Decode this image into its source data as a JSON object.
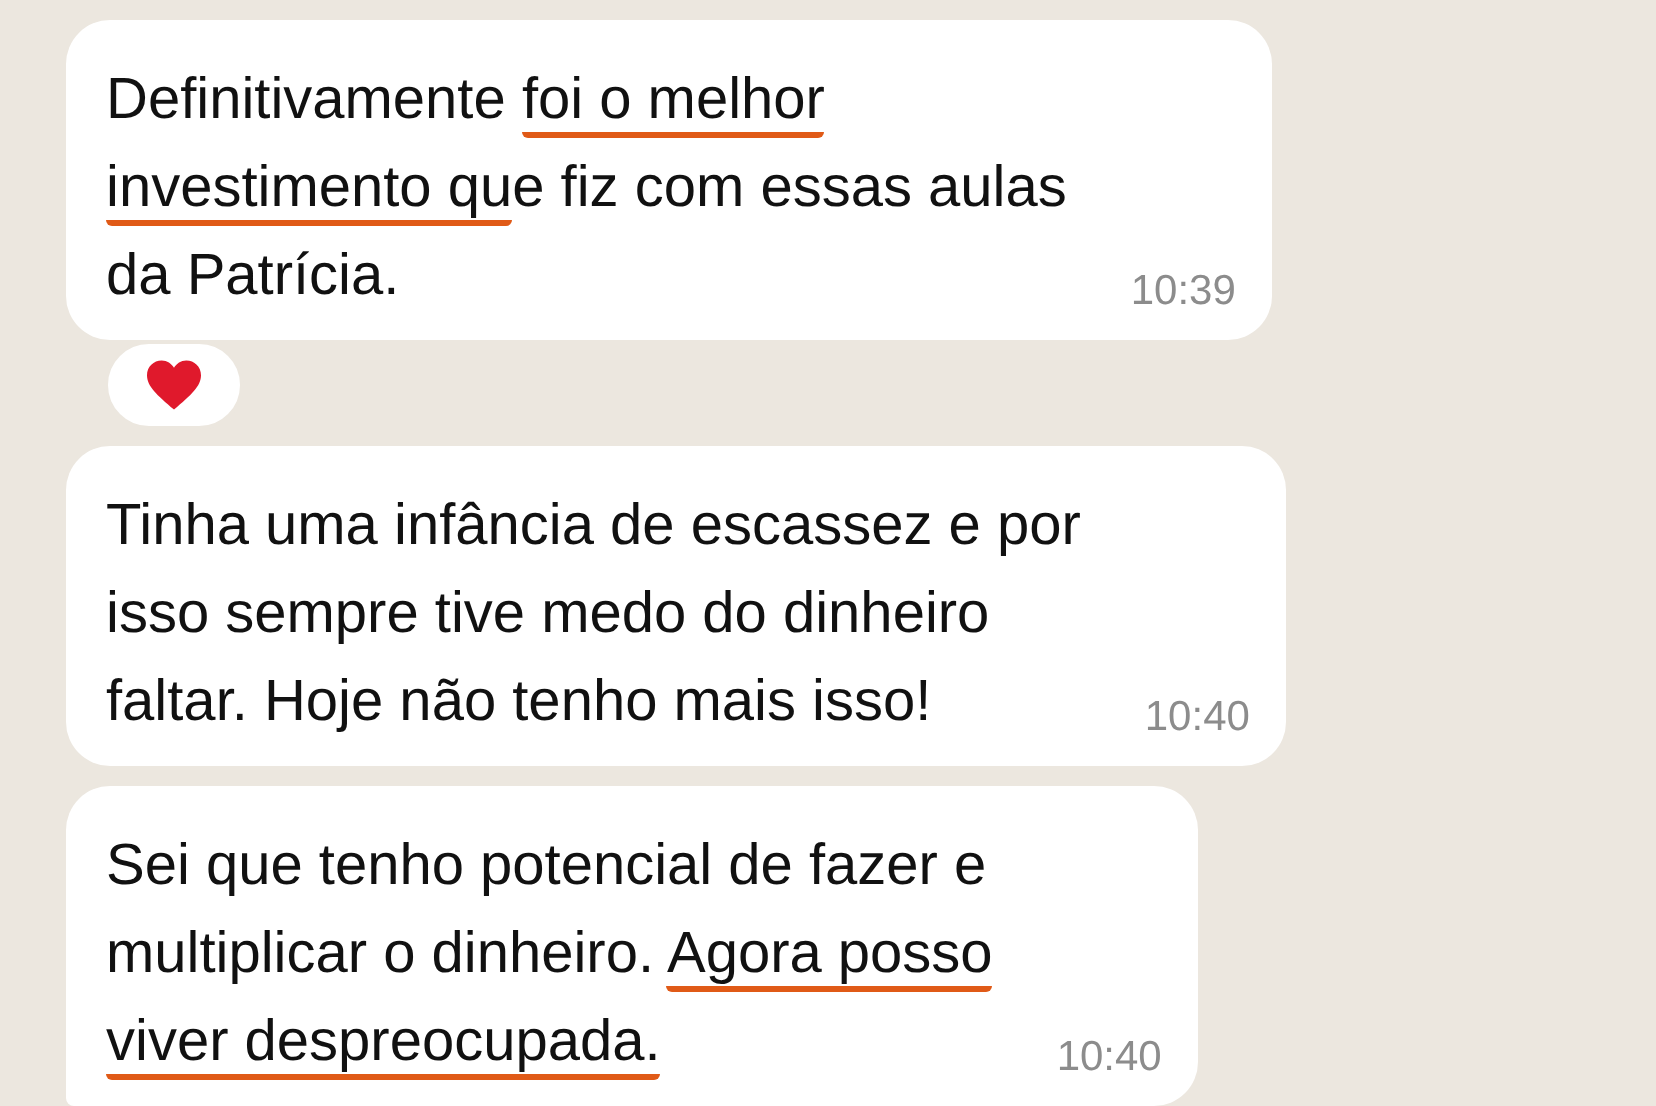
{
  "messages": [
    {
      "lines": [
        [
          {
            "text": "Definitivamente ",
            "underlined": false
          },
          {
            "text": "foi o melhor",
            "underlined": true
          }
        ],
        [
          {
            "text": "investimento qu",
            "underlined": true
          },
          {
            "text": "e fiz com essas aulas",
            "underlined": false
          }
        ],
        [
          {
            "text": "da Patrícia.",
            "underlined": false
          }
        ]
      ],
      "time": "10:39",
      "reaction": {
        "kind": "heart"
      },
      "tail": false
    },
    {
      "lines": [
        [
          {
            "text": "Tinha uma infância de escassez e por",
            "underlined": false
          }
        ],
        [
          {
            "text": "isso sempre tive medo do dinheiro",
            "underlined": false
          }
        ],
        [
          {
            "text": "faltar. Hoje não tenho mais isso!",
            "underlined": false
          }
        ]
      ],
      "time": "10:40",
      "tail": false
    },
    {
      "lines": [
        [
          {
            "text": "Sei que tenho potencial de fazer e",
            "underlined": false
          }
        ],
        [
          {
            "text": "multiplicar o dinheiro. ",
            "underlined": false
          },
          {
            "text": "Agora posso",
            "underlined": true
          }
        ],
        [
          {
            "text": "viver despreocupada.",
            "underlined": true
          }
        ]
      ],
      "time": "10:40",
      "tail": true
    }
  ]
}
